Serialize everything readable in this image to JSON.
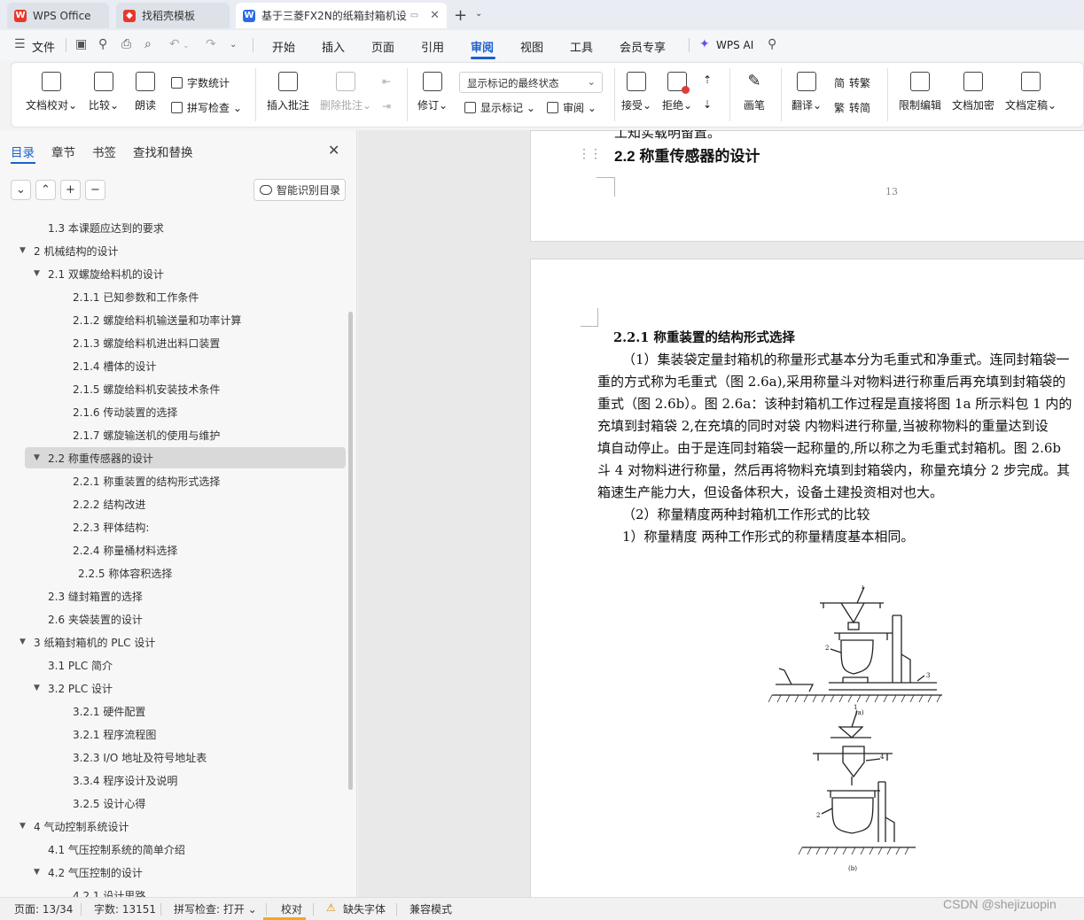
{
  "tabs": [
    {
      "label": "WPS Office",
      "icon": "wps-logo-icon",
      "color": "#e8372c"
    },
    {
      "label": "找稻壳模板",
      "icon": "docer-icon",
      "color": "#e8372c"
    },
    {
      "label": "基于三菱FX2N的纸箱封箱机设",
      "icon": "word-doc-icon",
      "color": "#2b6ce6"
    }
  ],
  "menu": {
    "file": "文件",
    "items": [
      "开始",
      "插入",
      "页面",
      "引用",
      "审阅",
      "视图",
      "工具",
      "会员专享"
    ],
    "active": "审阅",
    "ai": "WPS AI"
  },
  "ribbon": {
    "doc_check": "文档校对",
    "compare": "比较",
    "read_aloud": "朗读",
    "word_count": "字数统计",
    "spell_check": "拼写检查",
    "insert_comment": "插入批注",
    "delete_comment": "删除批注",
    "revise": "修订",
    "markup_state": "显示标记的最终状态",
    "show_markup": "显示标记",
    "review": "审阅",
    "accept": "接受",
    "reject": "拒绝",
    "pen": "画笔",
    "translate": "翻译",
    "to_traditional": "转繁",
    "to_simplified": "转简",
    "restrict_edit": "限制编辑",
    "encrypt": "文档加密",
    "finalize": "文档定稿"
  },
  "nav": {
    "tabs": [
      "目录",
      "章节",
      "书签",
      "查找和替换"
    ],
    "active_tab": "目录",
    "smart_toc": "智能识别目录",
    "toc": [
      {
        "label": "1.3  本课题应达到的要求",
        "level": 2,
        "arrow": ""
      },
      {
        "label": "2  机械结构的设计",
        "level": 1,
        "arrow": "▼"
      },
      {
        "label": "2.1  双螺旋给料机的设计",
        "level": 2,
        "arrow": "▼"
      },
      {
        "label": "2.1.1  已知参数和工作条件",
        "level": 3,
        "arrow": ""
      },
      {
        "label": "2.1.2  螺旋给料机输送量和功率计算",
        "level": 3,
        "arrow": ""
      },
      {
        "label": "2.1.3  螺旋给料机进出料口装置",
        "level": 3,
        "arrow": ""
      },
      {
        "label": "2.1.4  槽体的设计",
        "level": 3,
        "arrow": ""
      },
      {
        "label": "2.1.5  螺旋给料机安装技术条件",
        "level": 3,
        "arrow": ""
      },
      {
        "label": "2.1.6  传动装置的选择",
        "level": 3,
        "arrow": ""
      },
      {
        "label": "2.1.7  螺旋输送机的使用与维护",
        "level": 3,
        "arrow": ""
      },
      {
        "label": "2.2  称重传感器的设计",
        "level": 2,
        "arrow": "▼",
        "selected": true
      },
      {
        "label": "2.2.1  称重装置的结构形式选择",
        "level": 3,
        "arrow": ""
      },
      {
        "label": "2.2.2  结构改进",
        "level": 3,
        "arrow": ""
      },
      {
        "label": "2.2.3  秤体结构:",
        "level": 3,
        "arrow": ""
      },
      {
        "label": "2.2.4  称量桶材料选择",
        "level": 3,
        "arrow": ""
      },
      {
        "label": "2.2.5  称体容积选择",
        "level": 3,
        "arrow": "",
        "extra_indent": true
      },
      {
        "label": "2.3  缝封箱置的选择",
        "level": 2,
        "arrow": ""
      },
      {
        "label": "2.6  夹袋装置的设计",
        "level": 2,
        "arrow": ""
      },
      {
        "label": "3  纸箱封箱机的 PLC 设计",
        "level": 1,
        "arrow": "▼"
      },
      {
        "label": "3.1 PLC 简介",
        "level": 2,
        "arrow": ""
      },
      {
        "label": "3.2 PLC 设计",
        "level": 2,
        "arrow": "▼"
      },
      {
        "label": "3.2.1  硬件配置",
        "level": 3,
        "arrow": ""
      },
      {
        "label": "3.2.1  程序流程图",
        "level": 3,
        "arrow": ""
      },
      {
        "label": "3.2.3 I/O 地址及符号地址表",
        "level": 3,
        "arrow": ""
      },
      {
        "label": "3.3.4  程序设计及说明",
        "level": 3,
        "arrow": ""
      },
      {
        "label": "3.2.5  设计心得",
        "level": 3,
        "arrow": ""
      },
      {
        "label": "4  气动控制系统设计",
        "level": 1,
        "arrow": "▼"
      },
      {
        "label": "4.1  气压控制系统的简单介绍",
        "level": 2,
        "arrow": ""
      },
      {
        "label": "4.2  气压控制的设计",
        "level": 2,
        "arrow": "▼"
      },
      {
        "label": "4.2.1  设计思路",
        "level": 3,
        "arrow": ""
      }
    ]
  },
  "document": {
    "cutoff_text": "工知实载明留置。",
    "heading": "2.2  称重传感器的设计",
    "page_number": "13",
    "subheading": "2.2.1   称重装置的结构形式选择",
    "paragraphs": [
      "（1）集装袋定量封箱机的称量形式基本分为毛重式和净重式。连同封箱袋一",
      "重的方式称为毛重式（图 2.6a),采用称量斗对物料进行称重后再充填到封箱袋的",
      "重式（图 2.6b）。图 2.6a：该种封箱机工作过程是直接将图  1a  所示料包  1 内的",
      "充填到封箱袋 2,在充填的同时对袋 内物料进行称量,当被称物料的重量达到设",
      "填自动停止。由于是连同封箱袋一起称量的,所以称之为毛重式封箱机。图 2.6b",
      "斗 4 对物料进行称量，然后再将物料充填到封箱袋内，称量充填分 2 步完成。其",
      "箱速生产能力大，但设备体积大，设备土建投资相对也大。",
      "（2）称量精度两种封箱机工作形式的比较",
      "1）称量精度    两种工作形式的称量精度基本相同。"
    ],
    "figure_labels": [
      "1",
      "2",
      "3",
      "(a)",
      "1",
      "4",
      "2",
      "(b)"
    ]
  },
  "status": {
    "page": "页面: 13/34",
    "words": "字数: 13151",
    "spell": "拼写检查: 打开",
    "proof": "校对",
    "missing_font": "缺失字体",
    "compat": "兼容模式"
  },
  "watermark": "CSDN @shejizuopin"
}
